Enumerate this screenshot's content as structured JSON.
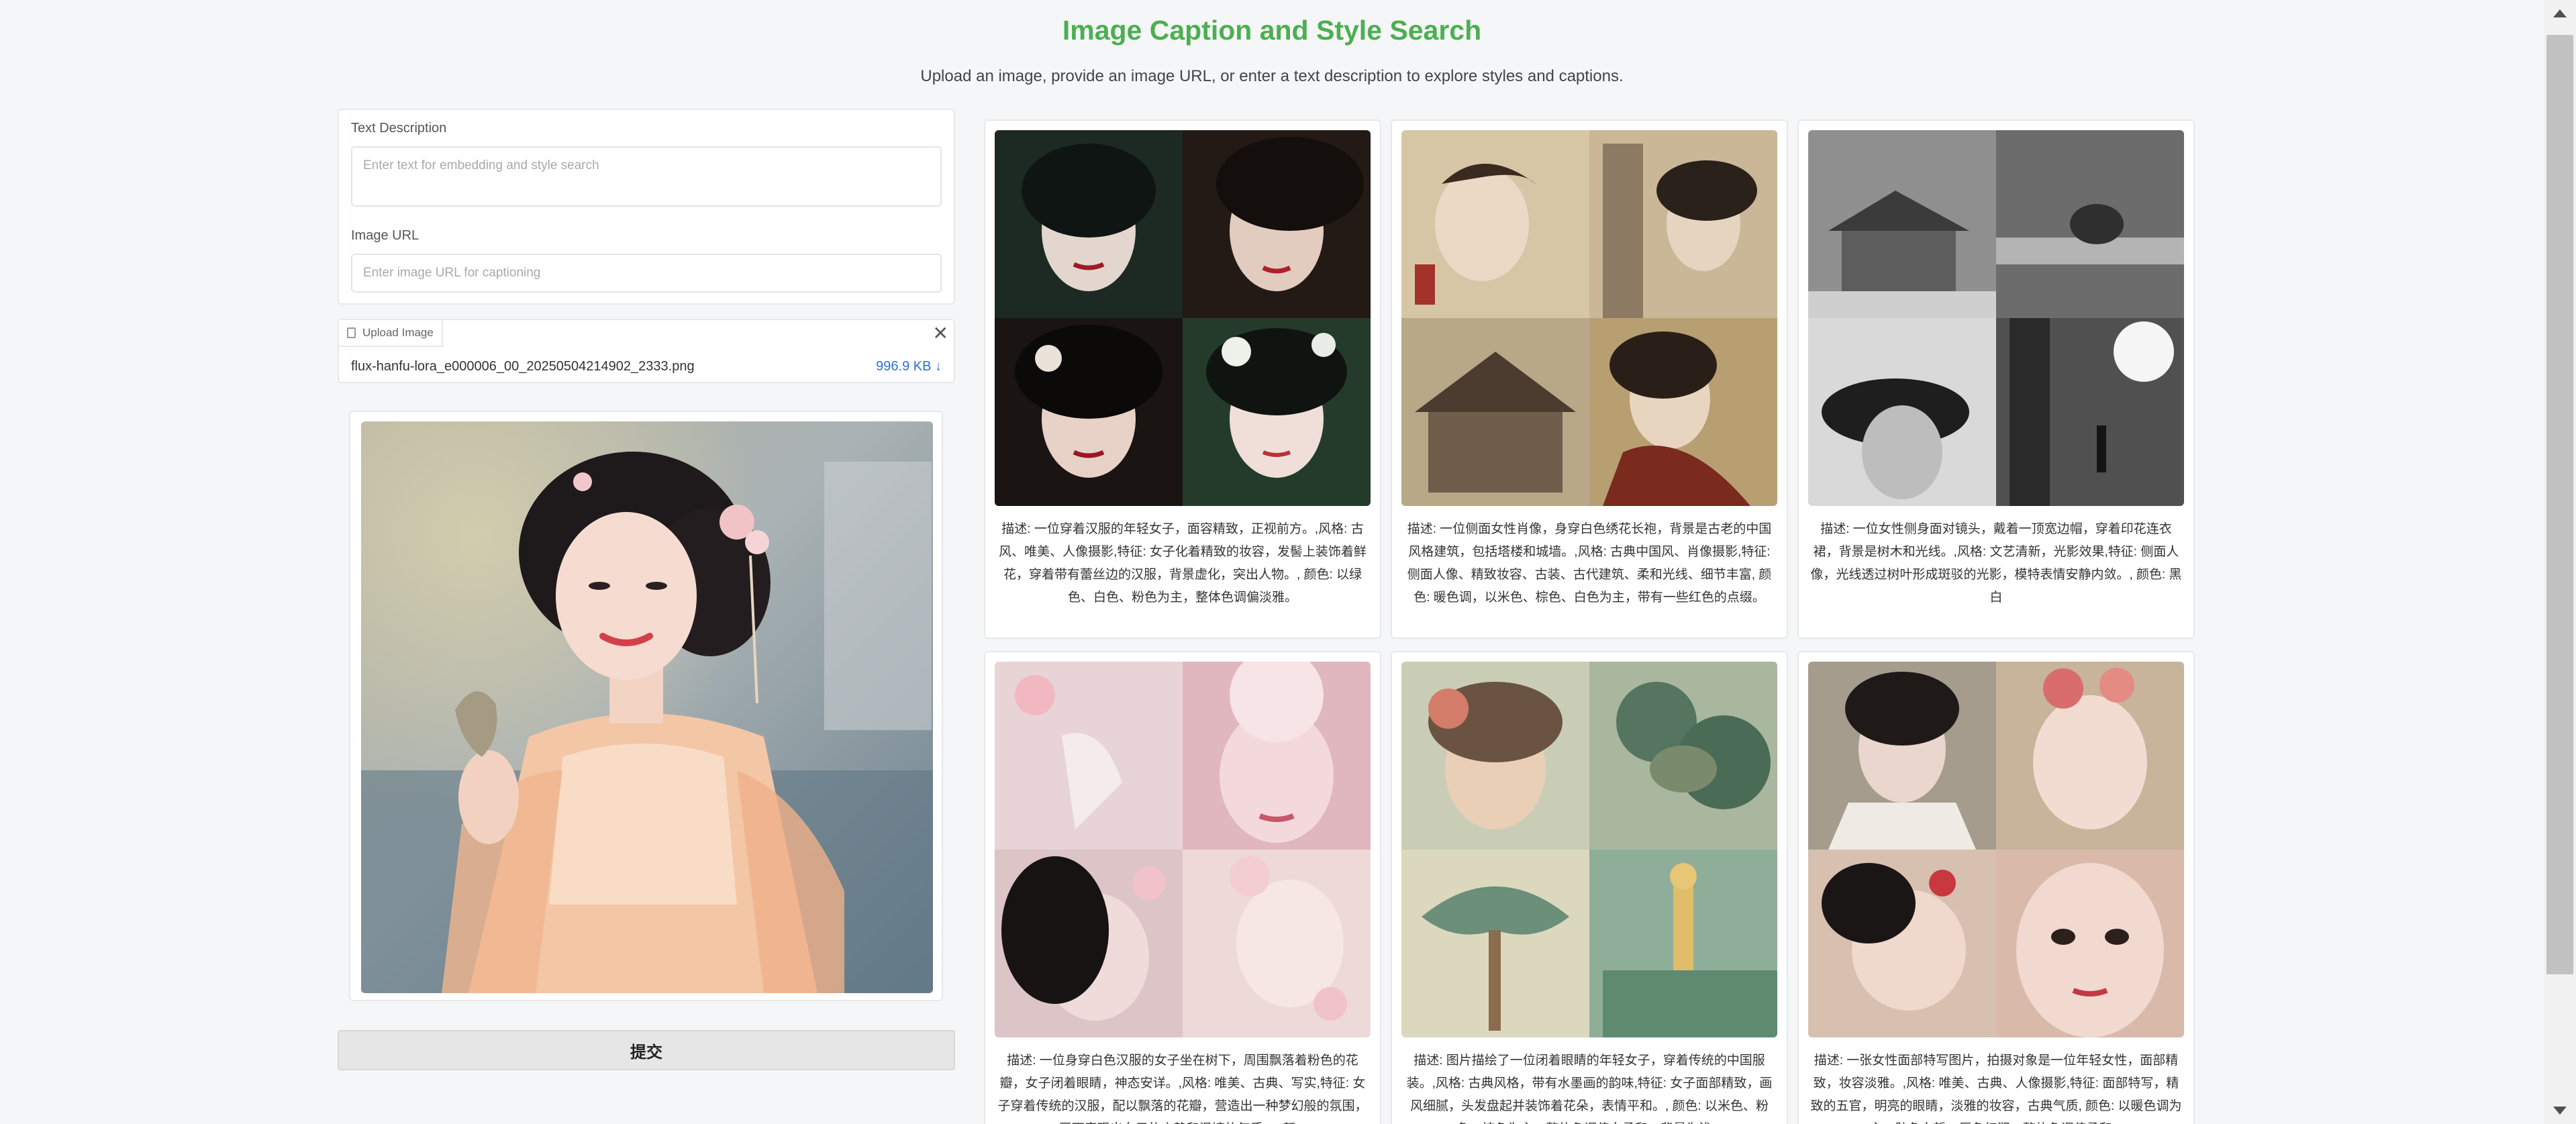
{
  "header": {
    "title": "Image Caption and Style Search",
    "subtitle": "Upload an image, provide an image URL, or enter a text description to explore styles and captions."
  },
  "form": {
    "text_label": "Text Description",
    "text_placeholder": "Enter text for embedding and style search",
    "url_label": "Image URL",
    "url_placeholder": "Enter image URL for captioning"
  },
  "upload": {
    "tab_label": "Upload Image",
    "file_name": "flux-hanfu-lora_e000006_00_20250504214902_2333.png",
    "file_size": "996.9 KB ↓"
  },
  "submit_label": "提交",
  "results": [
    {
      "caption": "描述: 一位穿着汉服的年轻女子，面容精致，正视前方。,风格: 古风、唯美、人像摄影,特征: 女子化着精致的妆容，发髻上装饰着鲜花，穿着带有蕾丝边的汉服，背景虚化，突出人物。, 颜色: 以绿色、白色、粉色为主，整体色调偏淡雅。"
    },
    {
      "caption": "描述: 一位侧面女性肖像，身穿白色绣花长袍，背景是古老的中国风格建筑，包括塔楼和城墙。,风格: 古典中国风、肖像摄影,特征: 侧面人像、精致妆容、古装、古代建筑、柔和光线、细节丰富, 颜色: 暖色调，以米色、棕色、白色为主，带有一些红色的点缀。"
    },
    {
      "caption": "描述: 一位女性侧身面对镜头，戴着一顶宽边帽，穿着印花连衣裙，背景是树木和光线。,风格: 文艺清新，光影效果,特征: 侧面人像，光线透过树叶形成斑驳的光影，模特表情安静内敛。, 颜色: 黑白"
    },
    {
      "caption": "描述: 一位身穿白色汉服的女子坐在树下，周围飘落着粉色的花瓣，女子闭着眼睛，神态安详。,风格: 唯美、古典、写实,特征: 女子穿着传统的汉服，配以飘落的花瓣，营造出一种梦幻般的氛围，画面表现出女子的宁静和温婉的气质。, 颜..."
    },
    {
      "caption": "描述: 图片描绘了一位闭着眼睛的年轻女子，穿着传统的中国服装。,风格: 古典风格，带有水墨画的韵味,特征: 女子面部精致，画风细腻，头发盘起并装饰着花朵，表情平和。, 颜色: 以米色、粉色、棕色为主，整体色调偏向柔和，背景为浅..."
    },
    {
      "caption": "描述: 一张女性面部特写图片，拍摄对象是一位年轻女性，面部精致，妆容淡雅。,风格: 唯美、古典、人像摄影,特征: 面部特写，精致的五官，明亮的眼睛，淡雅的妆容，古典气质, 颜色: 以暖色调为主，肤色白皙，唇色红润，整体色调偏柔和..."
    }
  ]
}
